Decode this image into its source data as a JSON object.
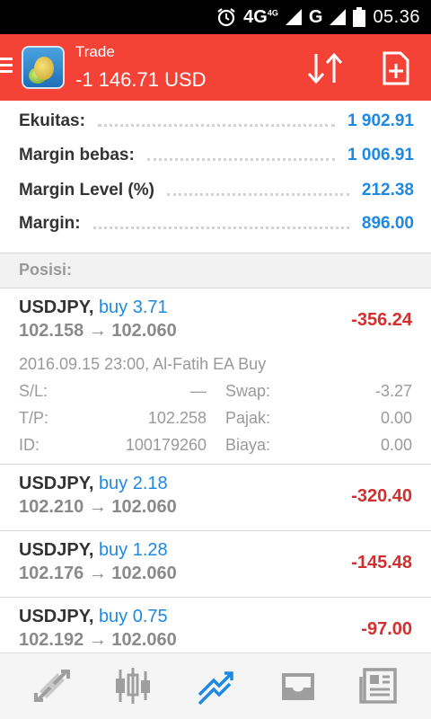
{
  "statusbar": {
    "network_label": "4G",
    "network_sup": "4G",
    "second_network": "G",
    "time": "05.36"
  },
  "header": {
    "title": "Trade",
    "profit": "-1 146.71 USD"
  },
  "summary": [
    {
      "label": "Ekuitas:",
      "value": "1 902.91"
    },
    {
      "label": "Margin bebas:",
      "value": "1 006.91"
    },
    {
      "label": "Margin Level (%)",
      "value": "212.38"
    },
    {
      "label": "Margin:",
      "value": "896.00"
    }
  ],
  "positions_header": "Posisi:",
  "positions": [
    {
      "symbol": "USDJPY,",
      "side": "buy 3.71",
      "prices": "102.158 → 102.060",
      "profit": "-356.24",
      "expanded": true,
      "details": {
        "open_time_comment": "2016.09.15 23:00, Al-Fatih EA Buy",
        "sl_label": "S/L:",
        "sl_value": "—",
        "tp_label": "T/P:",
        "tp_value": "102.258",
        "id_label": "ID:",
        "id_value": "100179260",
        "swap_label": "Swap:",
        "swap_value": "-3.27",
        "tax_label": "Pajak:",
        "tax_value": "0.00",
        "fee_label": "Biaya:",
        "fee_value": "0.00"
      }
    },
    {
      "symbol": "USDJPY,",
      "side": "buy 2.18",
      "prices": "102.210 → 102.060",
      "profit": "-320.40"
    },
    {
      "symbol": "USDJPY,",
      "side": "buy 1.28",
      "prices": "102.176 → 102.060",
      "profit": "-145.48"
    },
    {
      "symbol": "USDJPY,",
      "side": "buy 0.75",
      "prices": "102.192 → 102.060",
      "profit": "-97.00"
    }
  ],
  "bottom_nav": [
    {
      "icon": "quotes-icon",
      "active": false
    },
    {
      "icon": "chart-icon",
      "active": false
    },
    {
      "icon": "trade-icon",
      "active": true
    },
    {
      "icon": "history-icon",
      "active": false
    },
    {
      "icon": "news-icon",
      "active": false
    }
  ],
  "colors": {
    "header_bg": "#f44336",
    "value_blue": "#1e88e5",
    "loss_red": "#d32f2f",
    "active_nav": "#1e88e5",
    "inactive_nav": "#9e9e9e"
  }
}
